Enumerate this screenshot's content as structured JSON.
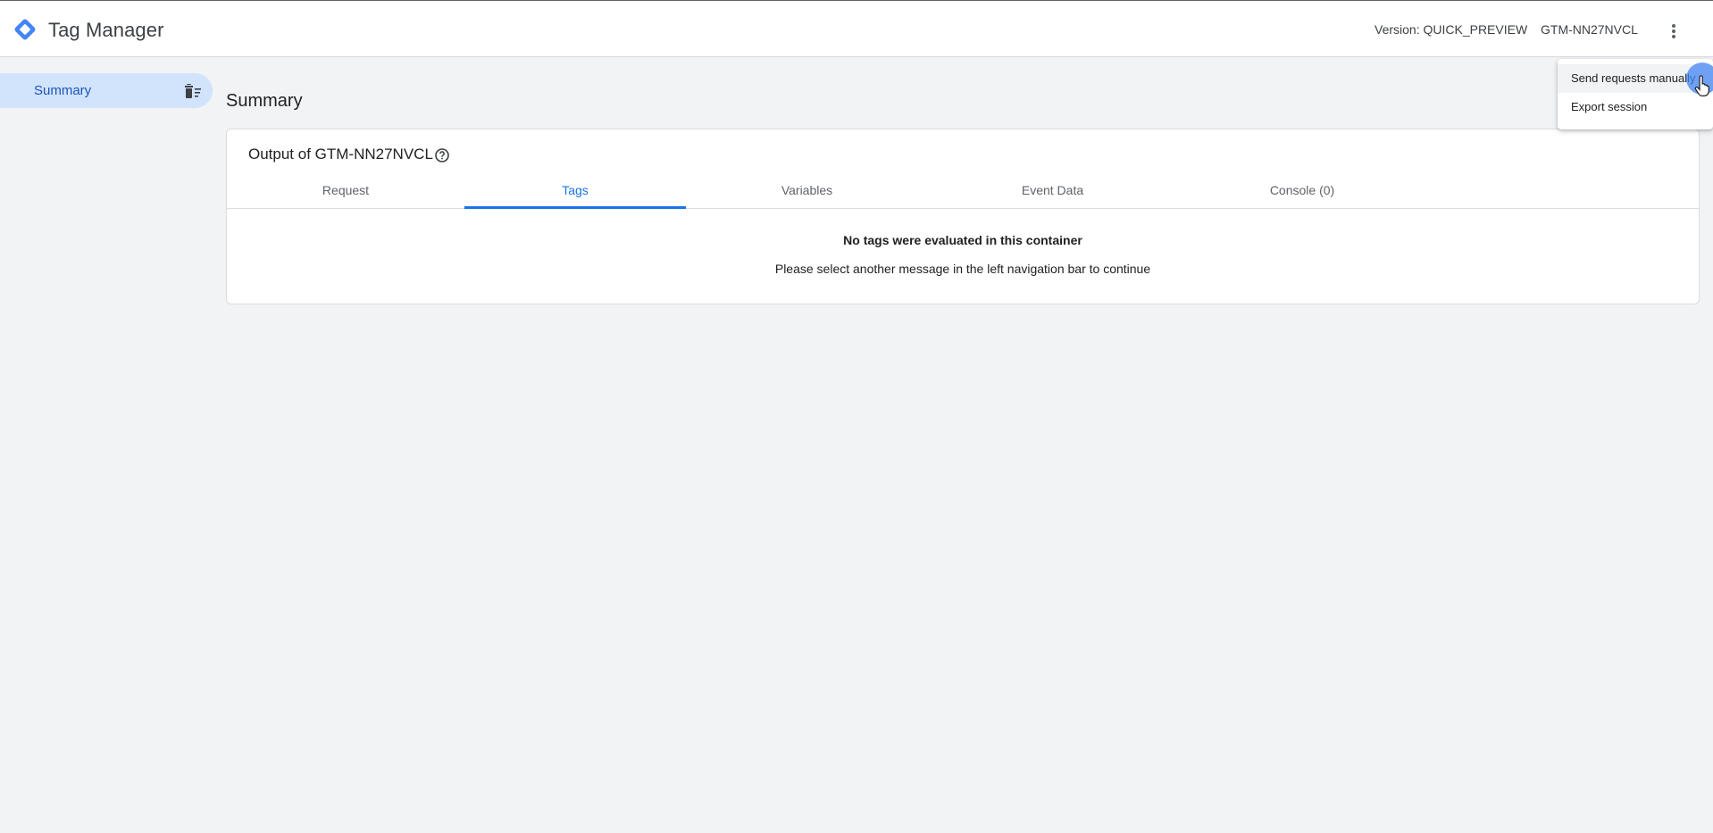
{
  "header": {
    "app_title": "Tag Manager",
    "version_text": "Version: QUICK_PREVIEW",
    "container_id": "GTM-NN27NVCL",
    "more_icon": "more-vert-icon",
    "brand_colors": [
      "#8ab4f8",
      "#4285f4",
      "#1967d2"
    ]
  },
  "sidebar": {
    "items": [
      {
        "label": "Summary",
        "icon": "delete-sweep-icon",
        "selected": true
      }
    ]
  },
  "main": {
    "page_title": "Summary",
    "card": {
      "title": "Output of GTM-NN27NVCL",
      "help_icon": "help-circle-icon",
      "tabs": [
        {
          "label": "Request",
          "active": false
        },
        {
          "label": "Tags",
          "active": true
        },
        {
          "label": "Variables",
          "active": false
        },
        {
          "label": "Event Data",
          "active": false
        },
        {
          "label": "Console (0)",
          "active": false
        }
      ],
      "empty_title": "No tags were evaluated in this container",
      "empty_subtitle": "Please select another message in the left navigation bar to continue"
    }
  },
  "menu": {
    "items": [
      {
        "label": "Send requests manually",
        "hovered": true
      },
      {
        "label": "Export session",
        "hovered": false
      }
    ]
  },
  "colors": {
    "accent": "#1a73e8",
    "selected_bg": "#d2e3fc",
    "page_bg": "#f1f3f4"
  }
}
